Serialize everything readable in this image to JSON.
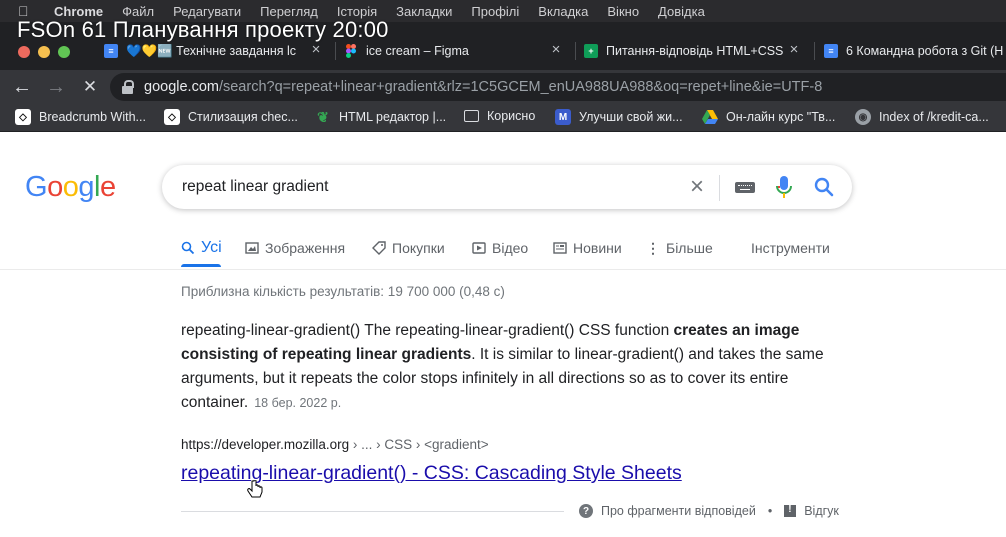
{
  "overlay_title": "FSOn 61 Планування проекту 20:00",
  "menubar": {
    "apple_icon": "apple-icon",
    "items": [
      "Chrome",
      "Файл",
      "Редагувати",
      "Перегляд",
      "Історія",
      "Закладки",
      "Профілі",
      "Вкладка",
      "Вікно",
      "Довідка"
    ]
  },
  "tabs": [
    {
      "title": "💙💛🆕 Технічне завдання lc",
      "icon": "google-docs-icon",
      "color": "#4285f4"
    },
    {
      "title": "ice cream – Figma",
      "icon": "figma-icon",
      "color": "#f24e1e"
    },
    {
      "title": "Питання-відповідь HTML+CSS",
      "icon": "google-sheets-icon",
      "color": "#0f9d58"
    },
    {
      "title": "6 Командна робота з Git (H",
      "icon": "google-docs-icon",
      "color": "#4285f4"
    }
  ],
  "toolbar": {
    "url_host": "google.com",
    "url_path": "/search?q=repeat+linear+gradient&rlz=1C5GCEM_enUA988UA988&oq=repet+line&ie=UTF-8"
  },
  "bookmarks": [
    {
      "label": "Breadcrumb With...",
      "icon": "codepen-icon"
    },
    {
      "label": "Стилизация chec...",
      "icon": "codepen-icon"
    },
    {
      "label": "HTML редактор |...",
      "icon": "leaf-icon"
    },
    {
      "label": "Корисно",
      "icon": "folder-icon"
    },
    {
      "label": "Улучши свой жи...",
      "icon": "m-icon"
    },
    {
      "label": "Он-лайн курс \"Тв...",
      "icon": "google-drive-icon"
    },
    {
      "label": "Index of /kredit-ca...",
      "icon": "globe-icon"
    }
  ],
  "search": {
    "query": "repeat linear gradient"
  },
  "result_tabs": [
    {
      "label": "Усі",
      "icon": "search-icon",
      "active": true
    },
    {
      "label": "Зображення",
      "icon": "image-icon"
    },
    {
      "label": "Покупки",
      "icon": "tag-icon"
    },
    {
      "label": "Відео",
      "icon": "play-icon"
    },
    {
      "label": "Новини",
      "icon": "news-icon"
    },
    {
      "label": "Більше",
      "icon": "more-vert-icon"
    },
    {
      "label": "Інструменти",
      "icon": ""
    }
  ],
  "stats": "Приблизна кількість результатів: 19 700 000 (0,48 с)",
  "snippet": {
    "part1": "repeating-linear-gradient() The repeating-linear-gradient() CSS function ",
    "bold": "creates an image consisting of repeating linear gradients",
    "part2": ". It is similar to linear-gradient() and takes the same arguments, but it repeats the color stops infinitely in all directions so as to cover its entire container.",
    "date": "18 бер. 2022 р."
  },
  "cite": {
    "url": "https://developer.mozilla.org",
    "crumbs": " › ... › CSS › <gradient>"
  },
  "result_title": "repeating-linear-gradient() - CSS: Cascading Style Sheets",
  "footer": {
    "about": "Про фрагменти відповідей",
    "dot": "•",
    "feedback": "Відгук"
  }
}
